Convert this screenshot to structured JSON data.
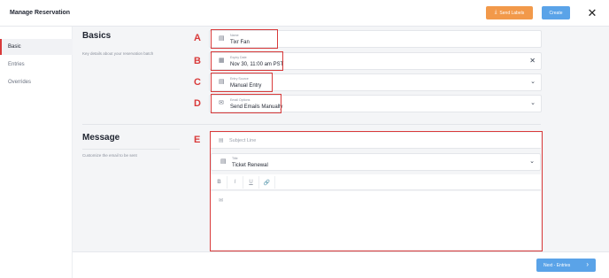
{
  "header": {
    "title": "Manage Reservation",
    "send_labels": "Send Labels",
    "create": "Create",
    "close_glyph": "✕"
  },
  "sidebar": {
    "items": [
      {
        "label": "Basic",
        "active": true
      },
      {
        "label": "Entries",
        "active": false
      },
      {
        "label": "Overrides",
        "active": false
      }
    ]
  },
  "basics": {
    "title": "Basics",
    "description": "Key details about your reservation batch",
    "fields": [
      {
        "letter": "A",
        "label": "Name",
        "value": "Tixr Fan",
        "icon": "form-icon",
        "right": ""
      },
      {
        "letter": "B",
        "label": "Expiry Date",
        "value": "Nov 30, 11:00 am PST",
        "icon": "calendar-icon",
        "right": "✕"
      },
      {
        "letter": "C",
        "label": "Entry Source",
        "value": "Manual Entry",
        "icon": "form-icon",
        "right": "⌄"
      },
      {
        "letter": "D",
        "label": "Email Options",
        "value": "Send Emails Manually",
        "icon": "email-icon",
        "right": "⌄"
      }
    ]
  },
  "message": {
    "letter": "E",
    "title": "Message",
    "description": "Customize the email to be sent",
    "subject_placeholder": "Subject Line",
    "title_field": {
      "label": "Title",
      "value": "Ticket Renewal"
    },
    "toolbar": {
      "bold": "B",
      "italic": "I",
      "underline": "U",
      "link": "🔗"
    }
  },
  "footer": {
    "next_label": "Next - Entries",
    "next_arrow": "›"
  },
  "colors": {
    "accent_blue": "#5aa3e8",
    "accent_orange": "#f2994a",
    "annotation_red": "#d93a3a"
  }
}
